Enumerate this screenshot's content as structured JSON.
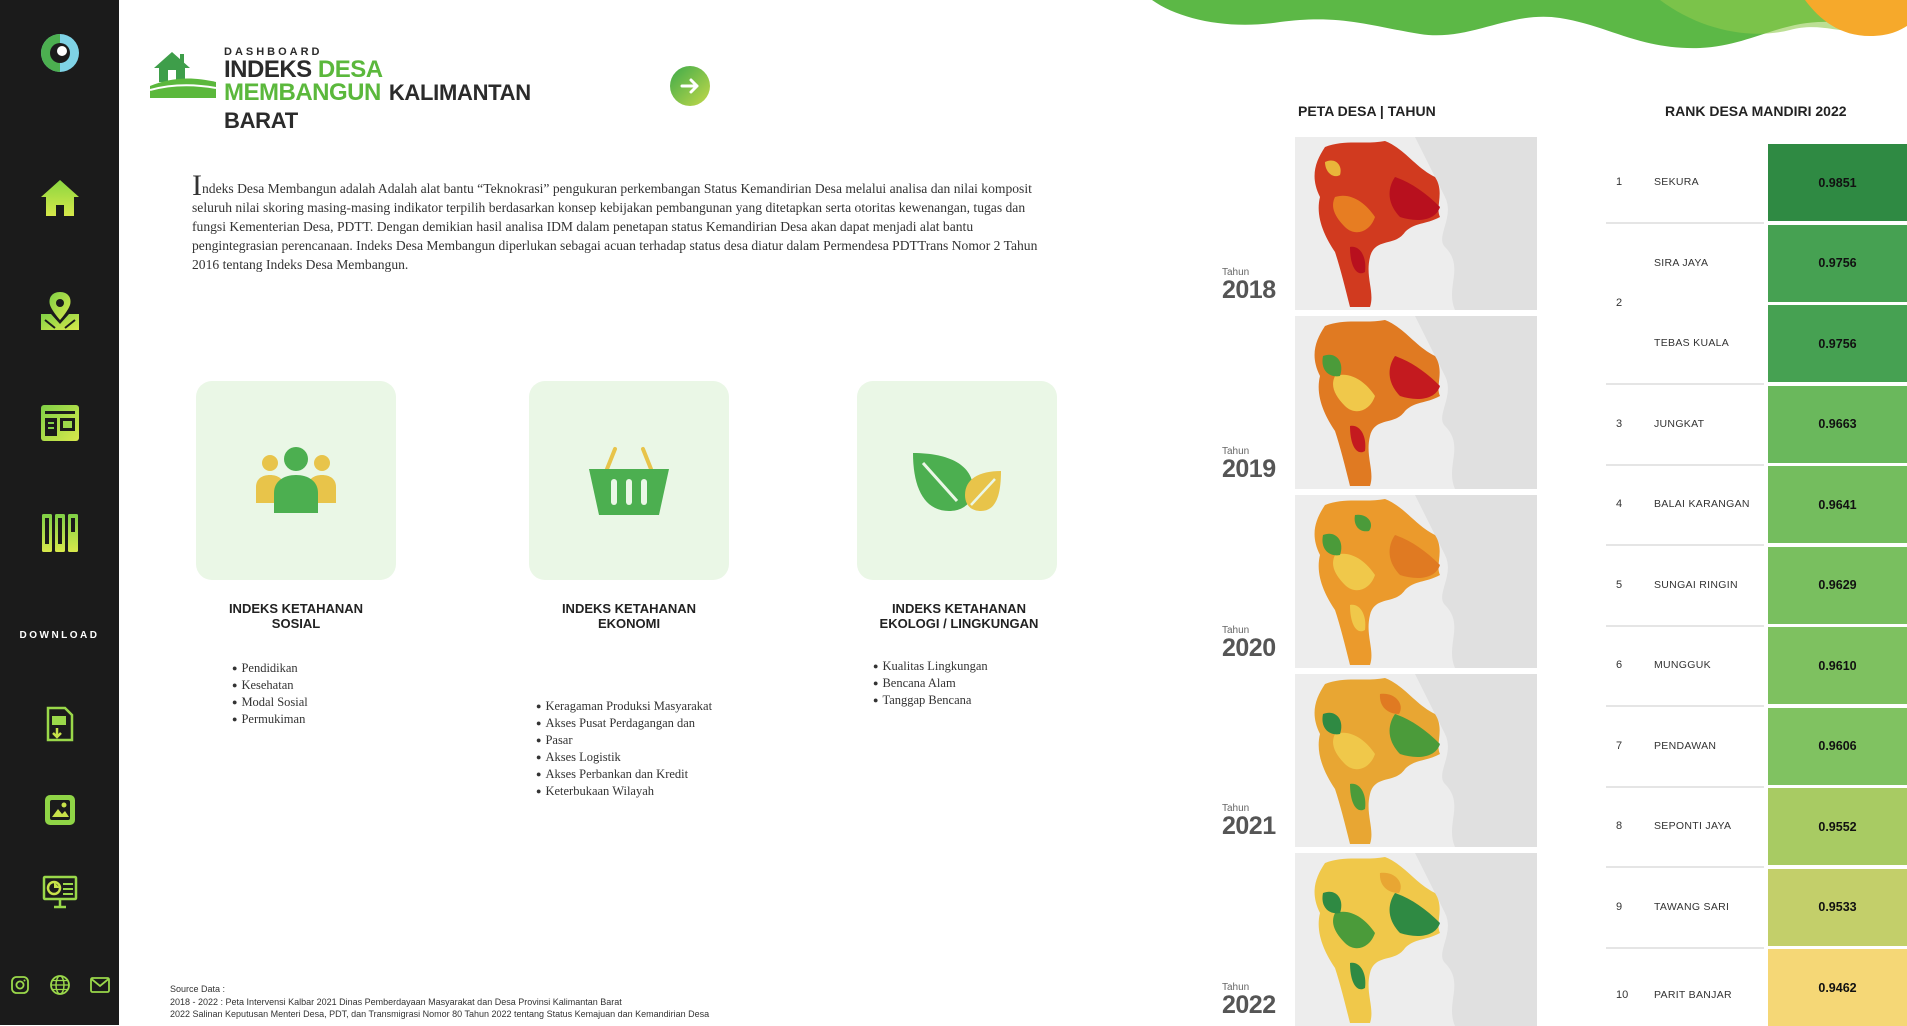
{
  "header": {
    "logo_small": "DASHBOARD",
    "logo_line1_a": "INDEKS",
    "logo_line1_b": "DESA",
    "logo_line2_a": "MEMBANGUN",
    "logo_line2_b": "KALIMANTAN BARAT"
  },
  "sidebar": {
    "download_label": "DOWNLOAD",
    "nav_icons": [
      "home-icon",
      "map-icon",
      "news-icon",
      "library-icon"
    ],
    "download_icons": [
      "pdf-download-icon",
      "image-icon",
      "presentation-icon"
    ],
    "social_icons": [
      "instagram-icon",
      "globe-icon",
      "mail-icon"
    ]
  },
  "intro": {
    "drop_cap": "I",
    "text": "ndeks Desa Membangun adalah Adalah alat bantu “Teknokrasi” pengukuran perkembangan Status Kemandirian Desa melalui analisa dan nilai komposit seluruh nilai skoring masing-masing indikator terpilih berdasarkan konsep kebijakan pembangunan yang ditetapkan serta otoritas kewenangan, tugas dan fungsi Kementerian Desa, PDTT. Dengan demikian hasil analisa IDM dalam penetapan status Kemandirian Desa akan dapat menjadi alat bantu pengintegrasian perencanaan. Indeks Desa Membangun diperlukan sebagai acuan terhadap status desa diatur dalam Permendesa PDTTrans Nomor 2 Tahun 2016 tentang Indeks Desa Membangun."
  },
  "indices": [
    {
      "title_1": "INDEKS KETAHANAN",
      "title_2": "SOSIAL",
      "icon": "people-icon",
      "items": [
        "Pendidikan",
        "Kesehatan",
        "Modal Sosial",
        "Permukiman"
      ]
    },
    {
      "title_1": "INDEKS KETAHANAN",
      "title_2": "EKONOMI",
      "icon": "basket-icon",
      "items": [
        "Keragaman Produksi Masyarakat",
        "Akses Pusat Perdagangan dan",
        "Pasar",
        "Akses Logistik",
        "Akses Perbankan dan Kredit",
        "Keterbukaan Wilayah"
      ]
    },
    {
      "title_1": "INDEKS KETAHANAN",
      "title_2": "EKOLOGI / LINGKUNGAN",
      "icon": "leaf-icon",
      "items": [
        "Kualitas Lingkungan",
        "Bencana Alam",
        "Tanggap Bencana"
      ]
    }
  ],
  "source": {
    "label": "Source Data :",
    "line1": "2018 - 2022 : Peta Intervensi Kalbar 2021 Dinas Pemberdayaan Masyarakat dan Desa Provinsi Kalimantan Barat",
    "line2": "2022 Salinan Keputusan Menteri Desa, PDT, dan Transmigrasi Nomor 80 Tahun 2022 tentang Status Kemajuan dan Kemandirian Desa"
  },
  "maps": {
    "title": "PETA DESA | TAHUN",
    "year_prefix": "Tahun",
    "years": [
      "2018",
      "2019",
      "2020",
      "2021",
      "2022"
    ]
  },
  "rank": {
    "title": "RANK DESA MANDIRI 2022",
    "rows": [
      {
        "rank": "1",
        "name": "SEKURA",
        "value": "0.9851",
        "color": "#2f8a43"
      },
      {
        "rank": "2",
        "name": "SIRA JAYA",
        "value": "0.9756",
        "color": "#46a152"
      },
      {
        "rank": "",
        "name": "TEBAS KUALA",
        "value": "0.9756",
        "color": "#46a152"
      },
      {
        "rank": "3",
        "name": "JUNGKAT",
        "value": "0.9663",
        "color": "#6ab85c"
      },
      {
        "rank": "4",
        "name": "BALAI KARANGAN",
        "value": "0.9641",
        "color": "#74bd5e"
      },
      {
        "rank": "5",
        "name": "SUNGAI RINGIN",
        "value": "0.9629",
        "color": "#79bf5f"
      },
      {
        "rank": "6",
        "name": "MUNGGUK",
        "value": "0.9610",
        "color": "#7ec160"
      },
      {
        "rank": "7",
        "name": "PENDAWAN",
        "value": "0.9606",
        "color": "#80c261"
      },
      {
        "rank": "8",
        "name": "SEPONTI JAYA",
        "value": "0.9552",
        "color": "#a8cb63"
      },
      {
        "rank": "9",
        "name": "TAWANG SARI",
        "value": "0.9533",
        "color": "#c3cf6a"
      },
      {
        "rank": "10",
        "name": "PARIT BANJAR",
        "value": "0.9462",
        "color": "#f5d776"
      }
    ]
  }
}
